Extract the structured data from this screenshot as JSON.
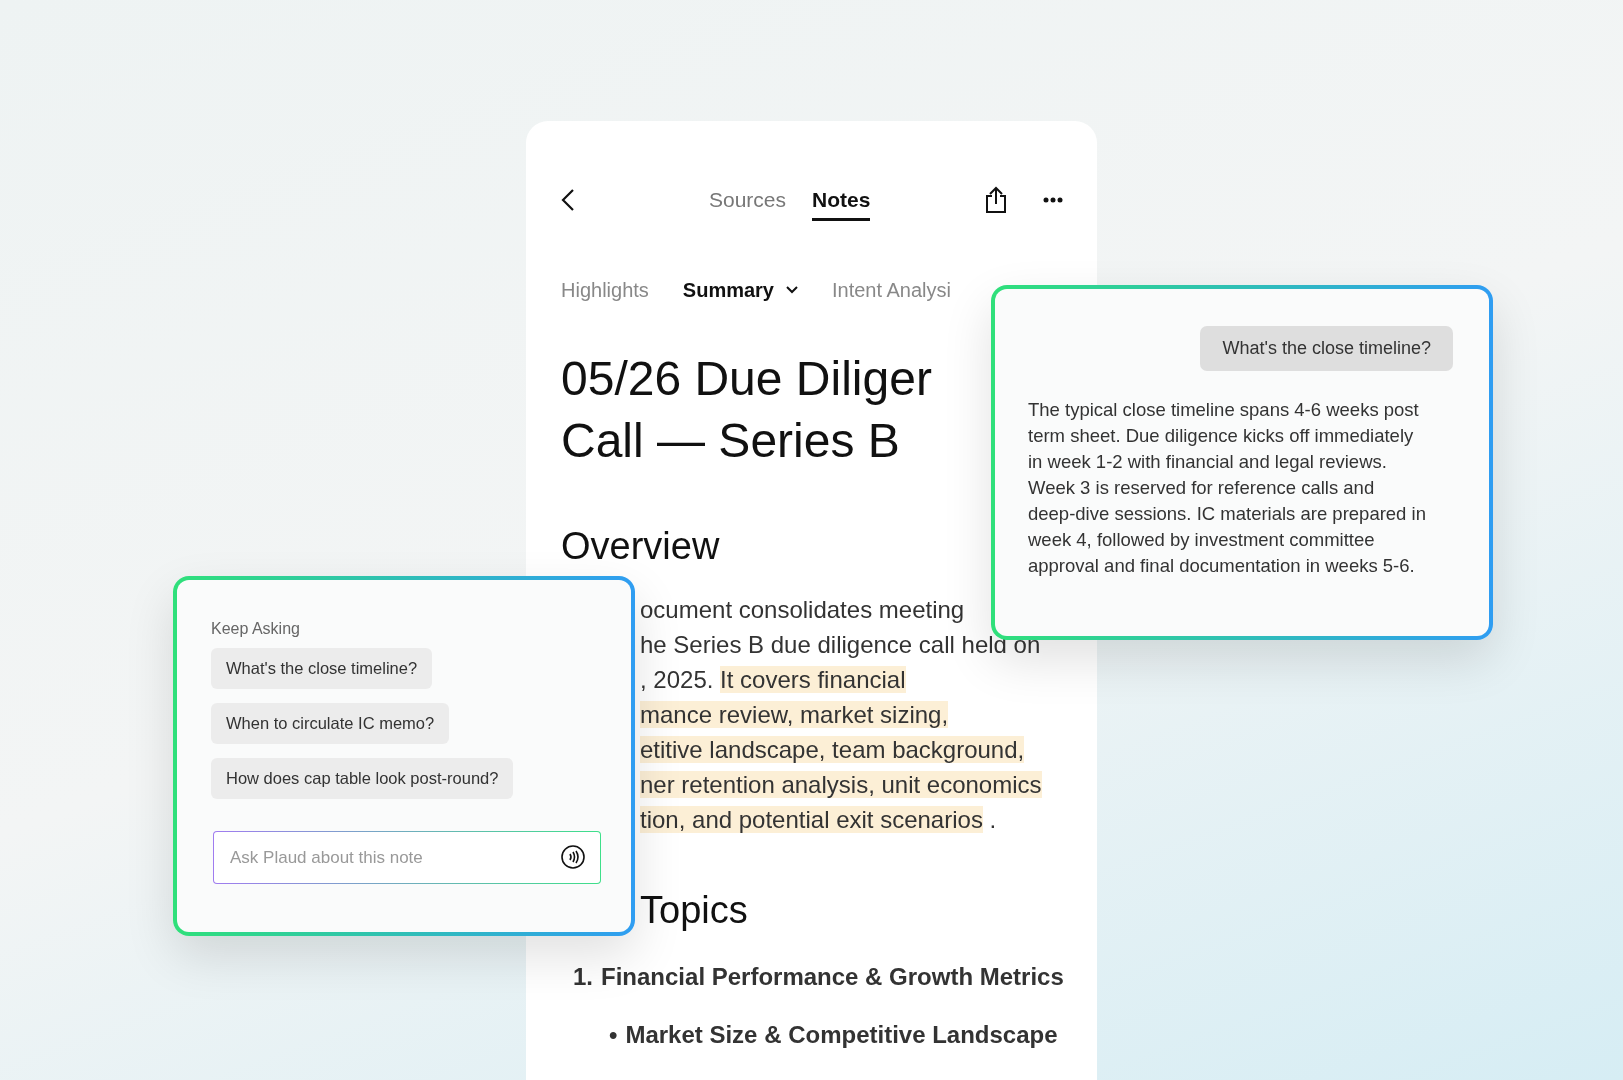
{
  "header": {
    "tabs": [
      {
        "label": "Sources",
        "selected": false
      },
      {
        "label": "Notes",
        "selected": true
      }
    ]
  },
  "subtabs": [
    {
      "label": "Highlights",
      "selected": false,
      "dropdown": false
    },
    {
      "label": "Summary",
      "selected": true,
      "dropdown": true
    },
    {
      "label": "Intent Analysi",
      "selected": false,
      "dropdown": false
    }
  ],
  "document": {
    "title_lines": [
      "05/26 Due Diliger",
      "Call — Series B"
    ],
    "overview": {
      "heading": "Overview",
      "lines": [
        {
          "segments": [
            {
              "text": "ocument consolidates meeting",
              "highlighted": false
            }
          ]
        },
        {
          "segments": [
            {
              "text": "he Series B due diligence call held on",
              "highlighted": false
            }
          ]
        },
        {
          "segments": [
            {
              "text": ", 2025.",
              "highlighted": false
            },
            {
              "text": "It covers financial",
              "highlighted": true
            }
          ]
        },
        {
          "segments": [
            {
              "text": "mance review, market sizing,",
              "highlighted": true
            }
          ]
        },
        {
          "segments": [
            {
              "text": "etitive landscape, team background,",
              "highlighted": true
            }
          ]
        },
        {
          "segments": [
            {
              "text": "ner retention analysis, unit economics",
              "highlighted": true
            }
          ]
        },
        {
          "segments": [
            {
              "text": "tion, and potential exit scenarios",
              "highlighted": true
            },
            {
              "text": ".",
              "highlighted": false
            }
          ]
        }
      ]
    },
    "topics": {
      "heading": "Topics",
      "items": [
        {
          "marker": "1.",
          "text": "Financial Performance & Growth Metrics",
          "children": [
            {
              "marker": "•",
              "text": "Market Size & Competitive Landscape"
            }
          ]
        }
      ]
    }
  },
  "keep_asking": {
    "title": "Keep Asking",
    "suggestions": [
      "What's the close timeline?",
      "When to circulate IC memo?",
      "How does cap table look post-round?"
    ],
    "input": {
      "placeholder": "Ask Plaud about this note"
    }
  },
  "chat": {
    "question": "What's the close timeline?",
    "answer": "The typical close timeline spans 4-6 weeks post term sheet. Due diligence kicks off immediately in week 1-2 with financial and legal reviews. Week 3 is reserved for reference calls and deep-dive sessions. IC materials are prepared in week 4, followed by investment committee approval and final documentation in weeks 5-6."
  }
}
